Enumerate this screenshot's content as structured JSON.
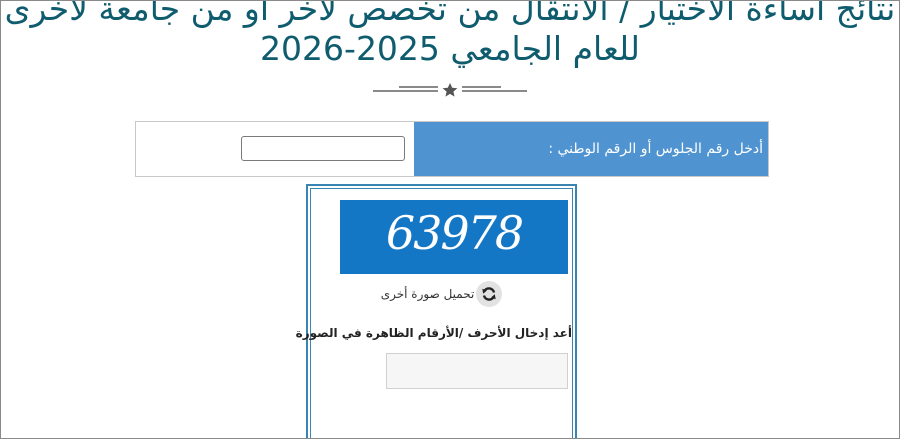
{
  "header": {
    "title_line1": "نتائج اساءة الاختيار / الانتقال من تخصص لآخر او من جامعة لأخرى",
    "title_line2": "للعام الجامعي 2025-2026"
  },
  "form": {
    "id_label": "أدخل رقم الجلوس أو الرقم الوطني :",
    "id_value": "",
    "id_placeholder": ""
  },
  "captcha": {
    "code": "63978",
    "reload_label": "تحميل صورة أخرى",
    "instruction": "أعد إدخال الأحرف /الأرقام الظاهرة في الصورة",
    "input_value": "",
    "input_placeholder": ""
  },
  "icons": {
    "divider": "star-icon",
    "reload": "refresh-icon"
  },
  "colors": {
    "title": "#0f5c6e",
    "label_bg": "#4f93d1",
    "captcha_bg": "#1477c5",
    "border_blue": "#3a84b3"
  }
}
